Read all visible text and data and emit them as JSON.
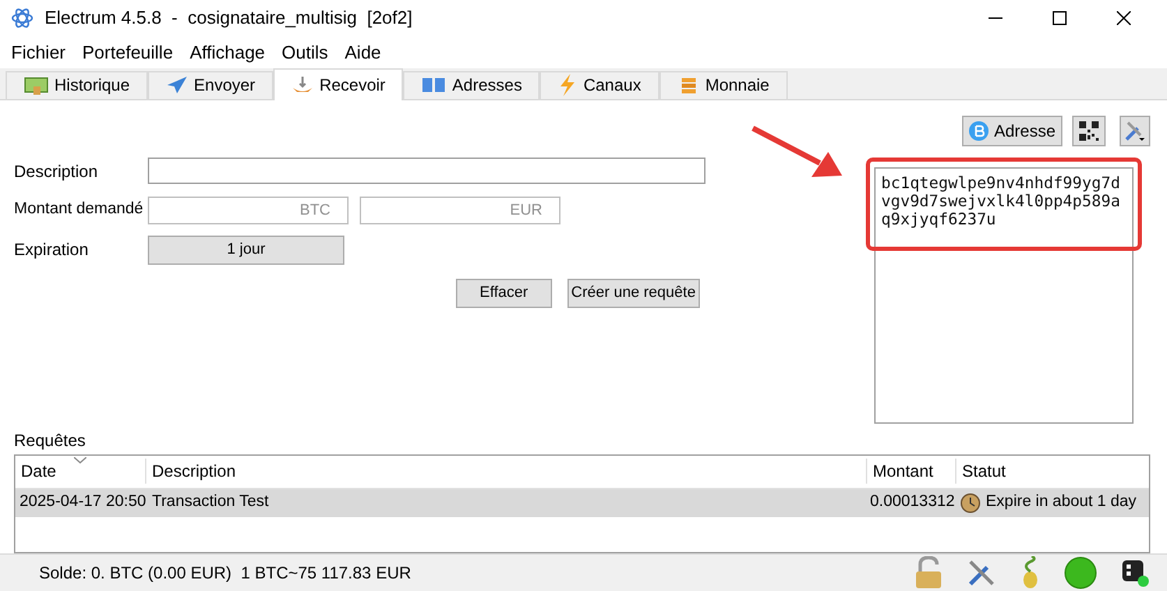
{
  "window": {
    "title": "Electrum 4.5.8  -  cosignataire_multisig  [2of2]"
  },
  "menu": [
    "Fichier",
    "Portefeuille",
    "Affichage",
    "Outils",
    "Aide"
  ],
  "tabs": [
    {
      "label": "Historique",
      "kind": "history",
      "selected": false
    },
    {
      "label": "Envoyer",
      "kind": "send",
      "selected": false
    },
    {
      "label": "Recevoir",
      "kind": "receive",
      "selected": true
    },
    {
      "label": "Adresses",
      "kind": "addresses",
      "selected": false
    },
    {
      "label": "Canaux",
      "kind": "channels",
      "selected": false
    },
    {
      "label": "Monnaie",
      "kind": "coins",
      "selected": false
    }
  ],
  "form": {
    "description_label": "Description",
    "amount_label": "Montant demandé",
    "btc_placeholder": "BTC",
    "eur_placeholder": "EUR",
    "expiration_label": "Expiration",
    "expiration_value": "1 jour",
    "clear_button": "Effacer",
    "create_button": "Créer une requête"
  },
  "address_button": "Adresse",
  "address": "bc1qtegwlpe9nv4nhdf99yg7dvgv9d7swejvxlk4l0pp4p589aq9xjyqf6237u",
  "requests": {
    "label": "Requêtes",
    "columns": [
      "Date",
      "Description",
      "Montant",
      "Statut"
    ],
    "rows": [
      {
        "date": "2025-04-17 20:50",
        "description": "Transaction Test",
        "amount": "0.00013312",
        "status": "Expire in about 1 day",
        "selected": true
      }
    ]
  },
  "status_bar": {
    "balance": "Solde: 0. BTC (0.00 EUR)  1 BTC~75 117.83 EUR"
  }
}
